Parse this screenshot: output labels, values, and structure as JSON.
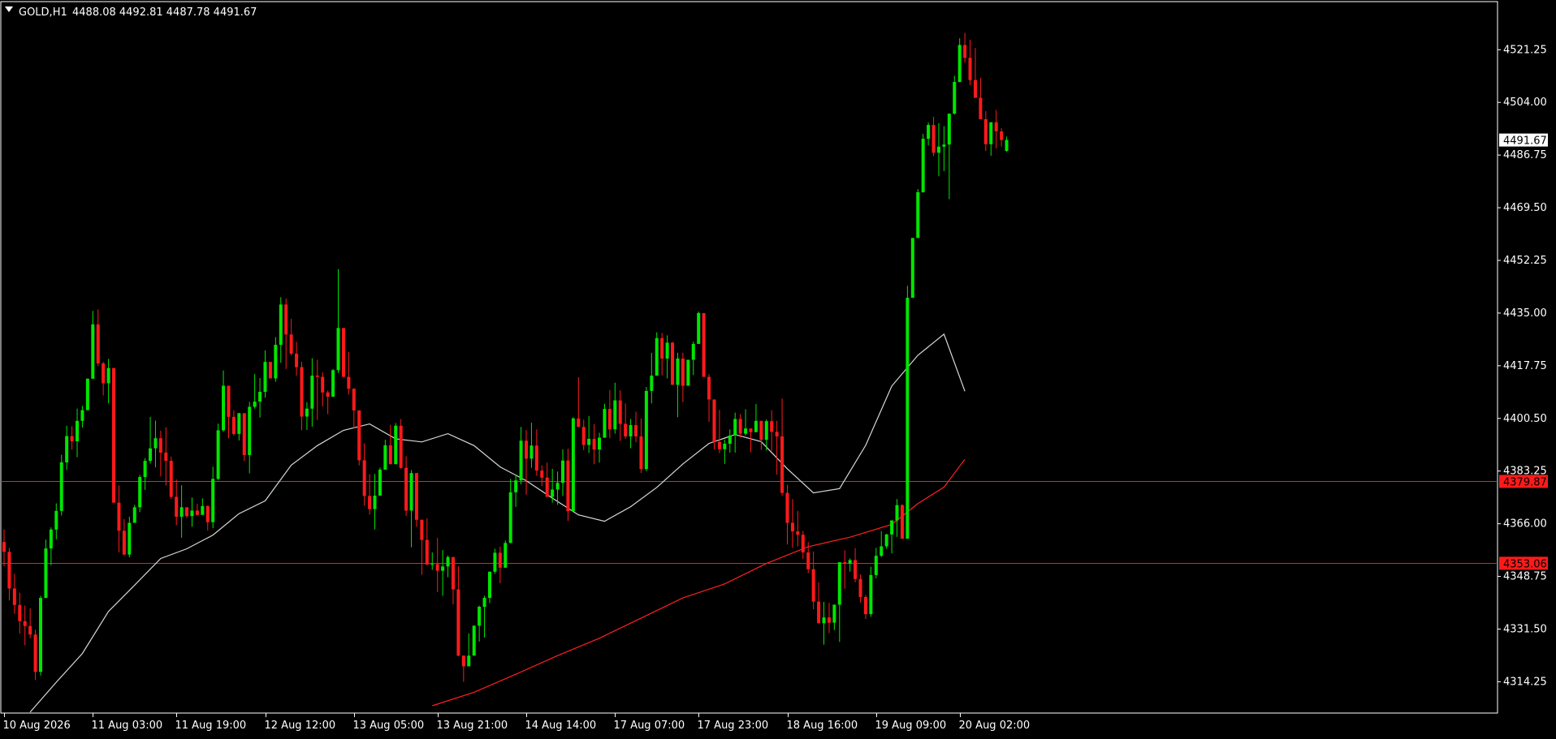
{
  "header": {
    "symbol": "GOLD,H1",
    "ohlc": "4488.08 4492.81 4487.78 4491.67"
  },
  "colors": {
    "background": "#000000",
    "bull": "#00E600",
    "bear": "#FF1A1A",
    "grid_text": "#FFFFFF",
    "ma_fast": "#D8D8D8",
    "ma_slow": "#FF2020",
    "hline": "#FF1A1A",
    "price_tag_bg": "#FFFFFF",
    "level_tag_bg": "#FF1A1A"
  },
  "chart_data": {
    "type": "candlestick",
    "title": "GOLD,H1",
    "ylim": [
      4304,
      4537
    ],
    "y_ticks": [
      4314.25,
      4331.5,
      4348.75,
      4366.0,
      4383.25,
      4400.5,
      4417.75,
      4435.0,
      4452.25,
      4469.5,
      4486.75,
      4504.0,
      4521.25
    ],
    "x_labels": [
      "10 Aug 2026",
      "11 Aug 03:00",
      "11 Aug 19:00",
      "12 Aug 12:00",
      "13 Aug 05:00",
      "13 Aug 21:00",
      "14 Aug 14:00",
      "17 Aug 07:00",
      "17 Aug 23:00",
      "18 Aug 16:00",
      "19 Aug 09:00",
      "20 Aug 02:00"
    ],
    "x_label_bar_index": [
      0,
      17,
      33,
      50,
      67,
      83,
      100,
      117,
      133,
      150,
      167,
      183
    ],
    "current_price": 4491.67,
    "horizontal_levels": [
      4379.87,
      4353.06
    ],
    "candles": [
      [
        4360.0,
        4364.1,
        4352.1,
        4356.8
      ],
      [
        4356.8,
        4358.1,
        4340.9,
        4344.8
      ],
      [
        4344.8,
        4349.6,
        4336.5,
        4339.4
      ],
      [
        4339.4,
        4343.4,
        4330.0,
        4334.1
      ],
      [
        4334.1,
        4339.2,
        4326.2,
        4332.5
      ],
      [
        4332.5,
        4338.3,
        4328.5,
        4329.7
      ],
      [
        4329.7,
        4331.3,
        4314.8,
        4317.5
      ],
      [
        4317.5,
        4342.4,
        4316.3,
        4341.7
      ],
      [
        4341.7,
        4360.8,
        4341.8,
        4357.9
      ],
      [
        4357.9,
        4364.8,
        4352.4,
        4364.1
      ],
      [
        4364.1,
        4372.7,
        4360.9,
        4370.2
      ],
      [
        4370.2,
        4388.6,
        4368.7,
        4386.1
      ],
      [
        4386.1,
        4398.1,
        4383.6,
        4394.7
      ],
      [
        4394.7,
        4397.9,
        4390.3,
        4393.0
      ],
      [
        4393.0,
        4403.7,
        4387.8,
        4399.7
      ],
      [
        4399.7,
        4404.6,
        4397.5,
        4403.2
      ],
      [
        4403.2,
        4413.6,
        4404.4,
        4413.5
      ],
      [
        4413.5,
        4435.7,
        4414.4,
        4431.3
      ],
      [
        4431.3,
        4436.2,
        4417.6,
        4418.5
      ],
      [
        4418.5,
        4419.0,
        4408.0,
        4412.0
      ],
      [
        4412.0,
        4420.0,
        4405.4,
        4417.0
      ],
      [
        4417.0,
        4413.2,
        4385.7,
        4372.9
      ],
      [
        4372.9,
        4378.5,
        4356.6,
        4363.7
      ],
      [
        4363.7,
        4367.5,
        4355.7,
        4355.9
      ],
      [
        4355.9,
        4368.3,
        4355.0,
        4366.3
      ],
      [
        4366.3,
        4372.2,
        4366.8,
        4371.4
      ],
      [
        4371.4,
        4382.0,
        4369.8,
        4381.3
      ],
      [
        4381.3,
        4387.5,
        4377.1,
        4386.6
      ],
      [
        4386.6,
        4401.0,
        4385.7,
        4390.7
      ],
      [
        4390.7,
        4399.8,
        4384.5,
        4394.0
      ],
      [
        4394.0,
        4396.5,
        4381.5,
        4389.3
      ],
      [
        4389.3,
        4397.6,
        4378.5,
        4386.6
      ],
      [
        4386.6,
        4388.0,
        4374.1,
        4374.8
      ],
      [
        4374.8,
        4380.5,
        4365.5,
        4368.3
      ],
      [
        4368.3,
        4378.6,
        4361.4,
        4371.4
      ],
      [
        4371.4,
        4369.4,
        4367.9,
        4368.5
      ],
      [
        4368.5,
        4374.6,
        4365.0,
        4370.3
      ],
      [
        4370.3,
        4372.5,
        4368.6,
        4368.9
      ],
      [
        4368.9,
        4374.3,
        4369.8,
        4371.8
      ],
      [
        4371.8,
        4372.0,
        4363.8,
        4366.5
      ],
      [
        4366.5,
        4384.7,
        4364.5,
        4380.7
      ],
      [
        4380.7,
        4398.8,
        4380.2,
        4396.6
      ],
      [
        4396.6,
        4416.2,
        4396.1,
        4411.2
      ],
      [
        4411.2,
        4410.1,
        4394.0,
        4401.0
      ],
      [
        4401.0,
        4403.2,
        4394.8,
        4395.4
      ],
      [
        4395.4,
        4402.3,
        4393.3,
        4402.2
      ],
      [
        4402.2,
        4399.2,
        4386.5,
        4388.5
      ],
      [
        4388.5,
        4405.9,
        4382.5,
        4404.3
      ],
      [
        4404.3,
        4415.0,
        4403.7,
        4406.0
      ],
      [
        4406.0,
        4413.7,
        4400.8,
        4409.2
      ],
      [
        4409.2,
        4422.8,
        4407.3,
        4419.0
      ],
      [
        4419.0,
        4418.0,
        4413.9,
        4413.6
      ],
      [
        4413.6,
        4427.1,
        4412.5,
        4424.6
      ],
      [
        4424.6,
        4440.2,
        4418.7,
        4437.8
      ],
      [
        4437.8,
        4439.7,
        4416.7,
        4428.0
      ],
      [
        4428.0,
        4433.1,
        4421.1,
        4421.7
      ],
      [
        4421.7,
        4425.6,
        4414.5,
        4417.3
      ],
      [
        4417.3,
        4419.0,
        4396.6,
        4401.1
      ],
      [
        4401.1,
        4405.8,
        4396.7,
        4403.7
      ],
      [
        4403.7,
        4420.2,
        4397.8,
        4414.5
      ],
      [
        4414.5,
        4419.7,
        4400.0,
        4414.1
      ],
      [
        4414.1,
        4415.6,
        4404.4,
        4409.0
      ],
      [
        4409.0,
        4409.6,
        4401.9,
        4407.6
      ],
      [
        4407.6,
        4416.7,
        4408.3,
        4416.3
      ],
      [
        4416.3,
        4449.4,
        4415.4,
        4430.1
      ],
      [
        4430.1,
        4430.1,
        4415.1,
        4414.1
      ],
      [
        4414.1,
        4422.2,
        4408.3,
        4410.2
      ],
      [
        4410.2,
        4410.4,
        4397.2,
        4403.1
      ],
      [
        4403.1,
        4402.3,
        4385.1,
        4386.8
      ],
      [
        4386.8,
        4392.3,
        4371.9,
        4375.1
      ],
      [
        4375.1,
        4382.2,
        4369.0,
        4370.8
      ],
      [
        4370.8,
        4382.3,
        4364.1,
        4375.2
      ],
      [
        4375.2,
        4384.4,
        4375.3,
        4383.7
      ],
      [
        4383.7,
        4393.5,
        4383.8,
        4391.7
      ],
      [
        4391.7,
        4398.4,
        4386.2,
        4385.5
      ],
      [
        4385.5,
        4399.0,
        4387.0,
        4398.1
      ],
      [
        4398.1,
        4400.3,
        4384.0,
        4384.3
      ],
      [
        4384.3,
        4388.1,
        4368.6,
        4370.3
      ],
      [
        4370.3,
        4383.6,
        4358.3,
        4382.6
      ],
      [
        4382.6,
        4382.2,
        4365.0,
        4367.3
      ],
      [
        4367.3,
        4367.4,
        4349.3,
        4360.7
      ],
      [
        4360.7,
        4367.8,
        4354.1,
        4352.6
      ],
      [
        4352.6,
        4356.6,
        4350.9,
        4352.8
      ],
      [
        4352.8,
        4361.4,
        4343.6,
        4350.6
      ],
      [
        4350.6,
        4357.4,
        4342.4,
        4352.0
      ],
      [
        4352.0,
        4355.6,
        4348.5,
        4355.1
      ],
      [
        4355.1,
        4353.7,
        4339.6,
        4344.5
      ],
      [
        4344.5,
        4352.1,
        4322.6,
        4322.8
      ],
      [
        4322.8,
        4321.9,
        4314.2,
        4319.3
      ],
      [
        4319.3,
        4330.1,
        4320.7,
        4322.8
      ],
      [
        4322.8,
        4332.7,
        4323.4,
        4332.6
      ],
      [
        4332.6,
        4339.2,
        4327.4,
        4338.8
      ],
      [
        4338.8,
        4342.4,
        4328.7,
        4341.7
      ],
      [
        4341.7,
        4350.2,
        4340.0,
        4350.3
      ],
      [
        4350.3,
        4357.8,
        4349.6,
        4356.5
      ],
      [
        4356.5,
        4358.5,
        4346.5,
        4351.6
      ],
      [
        4351.6,
        4360.5,
        4351.8,
        4359.7
      ],
      [
        4359.7,
        4380.7,
        4361.2,
        4376.3
      ],
      [
        4376.3,
        4382.2,
        4371.5,
        4380.2
      ],
      [
        4380.2,
        4397.7,
        4378.9,
        4393.2
      ],
      [
        4393.2,
        4396.7,
        4375.5,
        4387.3
      ],
      [
        4387.3,
        4399.1,
        4384.3,
        4391.6
      ],
      [
        4391.6,
        4396.9,
        4381.7,
        4383.4
      ],
      [
        4383.4,
        4385.1,
        4378.4,
        4381.1
      ],
      [
        4381.1,
        4386.0,
        4375.0,
        4374.8
      ],
      [
        4374.8,
        4384.0,
        4372.9,
        4377.2
      ],
      [
        4377.2,
        4383.1,
        4372.2,
        4379.4
      ],
      [
        4379.4,
        4390.4,
        4375.1,
        4386.7
      ],
      [
        4386.7,
        4390.6,
        4366.9,
        4370.1
      ],
      [
        4370.1,
        4400.9,
        4372.0,
        4400.5
      ],
      [
        4400.5,
        4414.0,
        4399.1,
        4397.7
      ],
      [
        4397.7,
        4400.1,
        4390.1,
        4391.8
      ],
      [
        4391.8,
        4401.3,
        4389.2,
        4393.8
      ],
      [
        4393.8,
        4398.6,
        4385.5,
        4390.3
      ],
      [
        4390.3,
        4395.8,
        4386.0,
        4394.2
      ],
      [
        4394.2,
        4405.3,
        4394.1,
        4403.6
      ],
      [
        4403.6,
        4409.8,
        4394.0,
        4396.9
      ],
      [
        4396.9,
        4412.2,
        4395.5,
        4406.4
      ],
      [
        4406.4,
        4409.7,
        4393.1,
        4398.7
      ],
      [
        4398.7,
        4405.4,
        4393.8,
        4394.6
      ],
      [
        4394.6,
        4400.3,
        4390.7,
        4398.3
      ],
      [
        4398.3,
        4402.7,
        4392.7,
        4394.6
      ],
      [
        4394.6,
        4400.5,
        4382.6,
        4383.9
      ],
      [
        4383.9,
        4410.8,
        4383.2,
        4409.5
      ],
      [
        4409.5,
        4422.0,
        4405.4,
        4414.5
      ],
      [
        4414.5,
        4428.7,
        4415.8,
        4426.8
      ],
      [
        4426.8,
        4428.5,
        4414.6,
        4420.1
      ],
      [
        4420.1,
        4427.7,
        4413.6,
        4425.3
      ],
      [
        4425.3,
        4425.6,
        4412.4,
        4411.5
      ],
      [
        4411.5,
        4422.0,
        4400.9,
        4420.1
      ],
      [
        4420.1,
        4422.0,
        4405.8,
        4411.2
      ],
      [
        4411.2,
        4419.4,
        4411.4,
        4419.7
      ],
      [
        4419.7,
        4425.7,
        4414.7,
        4424.9
      ],
      [
        4424.9,
        4435.5,
        4425.7,
        4435.0
      ],
      [
        4435.0,
        4434.3,
        4422.1,
        4414.1
      ],
      [
        4414.1,
        4415.0,
        4399.4,
        4406.7
      ],
      [
        4406.7,
        4406.0,
        4390.4,
        4392.8
      ],
      [
        4392.8,
        4403.3,
        4389.1,
        4390.4
      ],
      [
        4390.4,
        4393.6,
        4385.6,
        4392.2
      ],
      [
        4392.2,
        4396.9,
        4389.3,
        4394.9
      ],
      [
        4394.9,
        4402.4,
        4389.3,
        4400.3
      ],
      [
        4400.3,
        4401.9,
        4394.2,
        4395.5
      ],
      [
        4395.5,
        4403.5,
        4394.9,
        4397.2
      ],
      [
        4397.2,
        4396.4,
        4389.4,
        4396.0
      ],
      [
        4396.0,
        4405.2,
        4398.4,
        4399.7
      ],
      [
        4399.7,
        4398.5,
        4390.2,
        4393.5
      ],
      [
        4393.5,
        4400.2,
        4390.0,
        4399.6
      ],
      [
        4399.6,
        4403.2,
        4389.9,
        4396.1
      ],
      [
        4396.1,
        4399.7,
        4382.1,
        4394.6
      ],
      [
        4394.6,
        4407.0,
        4375.2,
        4376.1
      ],
      [
        4376.1,
        4378.8,
        4359.2,
        4366.3
      ],
      [
        4366.3,
        4374.1,
        4358.1,
        4363.5
      ],
      [
        4363.5,
        4370.2,
        4358.6,
        4362.4
      ],
      [
        4362.4,
        4363.6,
        4354.5,
        4356.6
      ],
      [
        4356.6,
        4360.0,
        4349.8,
        4351.1
      ],
      [
        4351.1,
        4356.9,
        4338.0,
        4340.5
      ],
      [
        4340.5,
        4346.8,
        4334.6,
        4333.4
      ],
      [
        4333.4,
        4340.4,
        4326.4,
        4335.3
      ],
      [
        4335.3,
        4340.1,
        4330.2,
        4333.6
      ],
      [
        4333.6,
        4335.8,
        4331.2,
        4339.5
      ],
      [
        4339.5,
        4352.6,
        4327.3,
        4353.4
      ],
      [
        4353.4,
        4357.3,
        4344.7,
        4352.9
      ],
      [
        4352.9,
        4354.6,
        4350.3,
        4354.1
      ],
      [
        4354.1,
        4358.0,
        4346.8,
        4347.9
      ],
      [
        4347.9,
        4349.4,
        4340.2,
        4342.0
      ],
      [
        4342.0,
        4342.6,
        4334.8,
        4336.4
      ],
      [
        4336.4,
        4351.9,
        4335.5,
        4349.2
      ],
      [
        4349.2,
        4358.1,
        4348.1,
        4355.5
      ],
      [
        4355.5,
        4363.6,
        4355.1,
        4358.6
      ],
      [
        4358.6,
        4362.7,
        4357.8,
        4362.5
      ],
      [
        4362.5,
        4366.2,
        4356.3,
        4367.1
      ],
      [
        4367.1,
        4374.1,
        4361.7,
        4372.1
      ],
      [
        4372.1,
        4372.4,
        4368.3,
        4361.1
      ],
      [
        4361.1,
        4443.9,
        4361.1,
        4440.0
      ],
      [
        4440.0,
        4459.6,
        4445.7,
        4459.6
      ],
      [
        4459.6,
        4475.6,
        4459.9,
        4474.6
      ],
      [
        4474.6,
        4493.7,
        4474.4,
        4492.1
      ],
      [
        4492.1,
        4497.4,
        4489.9,
        4496.6
      ],
      [
        4496.6,
        4499.3,
        4486.4,
        4487.5
      ],
      [
        4487.5,
        4497.2,
        4479.8,
        4489.5
      ],
      [
        4489.5,
        4496.2,
        4481.5,
        4490.2
      ],
      [
        4490.2,
        4500.0,
        4472.3,
        4500.3
      ],
      [
        4500.3,
        4512.7,
        4500.0,
        4510.7
      ],
      [
        4510.7,
        4525.0,
        4510.6,
        4522.8
      ],
      [
        4522.8,
        4526.8,
        4517.0,
        4518.6
      ],
      [
        4518.6,
        4524.5,
        4509.6,
        4511.3
      ],
      [
        4511.3,
        4521.8,
        4507.9,
        4505.5
      ],
      [
        4505.5,
        4512.0,
        4498.9,
        4498.5
      ],
      [
        4498.5,
        4501.1,
        4488.1,
        4490.3
      ],
      [
        4490.3,
        4493.2,
        4486.5,
        4497.5
      ],
      [
        4497.5,
        4501.5,
        4488.9,
        4494.5
      ],
      [
        4494.5,
        4495.6,
        4489.6,
        4491.7
      ],
      [
        4488.1,
        4492.8,
        4487.8,
        4491.7
      ]
    ],
    "ma_fast": [
      [
        5,
        4304.3
      ],
      [
        10,
        4314.1
      ],
      [
        15,
        4323.5
      ],
      [
        20,
        4337.3
      ],
      [
        25,
        4345.9
      ],
      [
        30,
        4354.6
      ],
      [
        35,
        4357.8
      ],
      [
        40,
        4362.3
      ],
      [
        45,
        4369.3
      ],
      [
        50,
        4373.5
      ],
      [
        55,
        4385.2
      ],
      [
        60,
        4391.6
      ],
      [
        65,
        4396.6
      ],
      [
        70,
        4398.7
      ],
      [
        75,
        4393.8
      ],
      [
        80,
        4392.8
      ],
      [
        85,
        4395.5
      ],
      [
        90,
        4391.6
      ],
      [
        95,
        4384.6
      ],
      [
        100,
        4380.1
      ],
      [
        105,
        4374.4
      ],
      [
        110,
        4368.9
      ],
      [
        115,
        4366.8
      ],
      [
        120,
        4371.6
      ],
      [
        125,
        4377.9
      ],
      [
        130,
        4385.6
      ],
      [
        135,
        4392.3
      ],
      [
        140,
        4395.2
      ],
      [
        145,
        4392.9
      ],
      [
        150,
        4384.0
      ],
      [
        155,
        4376.1
      ],
      [
        160,
        4377.5
      ],
      [
        165,
        4391.7
      ],
      [
        170,
        4411.1
      ],
      [
        175,
        4421.2
      ],
      [
        180,
        4428.1
      ],
      [
        184,
        4409.4
      ]
    ],
    "ma_slow": [
      [
        82,
        4306.4
      ],
      [
        90,
        4310.8
      ],
      [
        98,
        4316.7
      ],
      [
        106,
        4322.8
      ],
      [
        114,
        4328.5
      ],
      [
        122,
        4335.1
      ],
      [
        130,
        4341.7
      ],
      [
        138,
        4346.3
      ],
      [
        146,
        4353.0
      ],
      [
        154,
        4358.5
      ],
      [
        162,
        4361.6
      ],
      [
        170,
        4365.8
      ],
      [
        175,
        4372.6
      ],
      [
        180,
        4378.0
      ],
      [
        184,
        4387.1
      ]
    ]
  }
}
